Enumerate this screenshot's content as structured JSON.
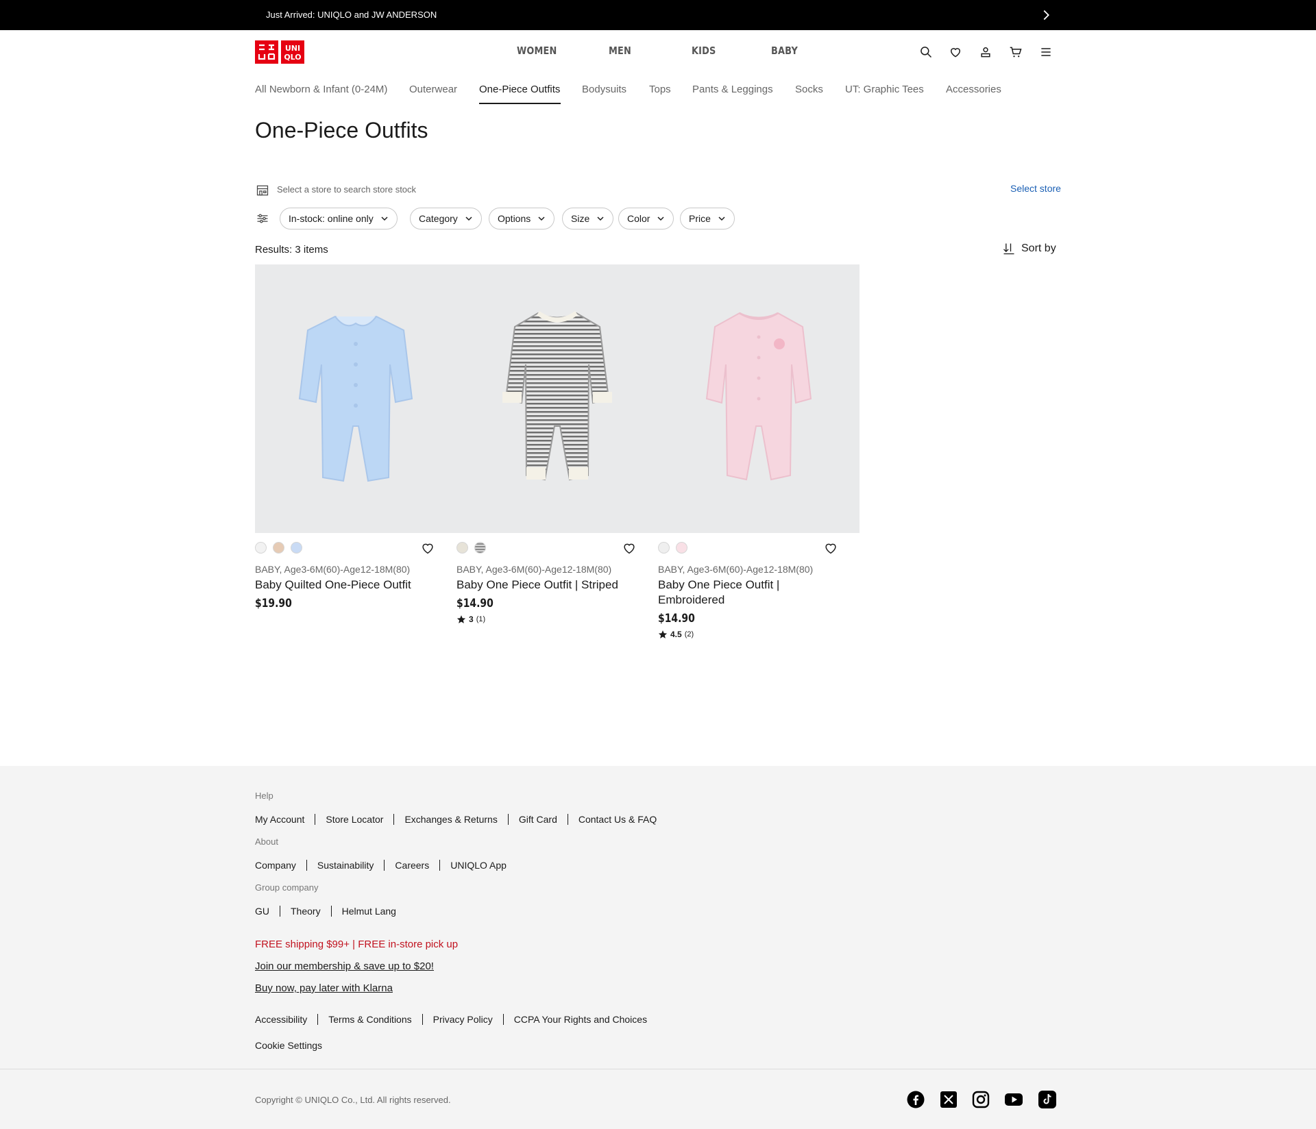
{
  "promo": {
    "text": "Just Arrived: UNIQLO and JW ANDERSON",
    "arrow_icon": "chevron-right-icon"
  },
  "logo": {
    "line1": "UNI",
    "line2": "QLO",
    "color": "#e60012"
  },
  "main_nav": [
    "WOMEN",
    "MEN",
    "KIDS",
    "BABY"
  ],
  "header_icons": [
    "search-icon",
    "heart-icon",
    "user-icon",
    "cart-icon",
    "menu-icon"
  ],
  "sub_nav": [
    "All Newborn & Infant (0-24M)",
    "Outerwear",
    "One-Piece Outfits",
    "Bodysuits",
    "Tops",
    "Pants & Leggings",
    "Socks",
    "UT: Graphic Tees",
    "Accessories"
  ],
  "sub_nav_active": "One-Piece Outfits",
  "page_title": "One-Piece Outfits",
  "store": {
    "text": "Select a store to search store stock",
    "link": "Select store"
  },
  "filters": [
    "In-stock: online only",
    "Category",
    "Options",
    "Size",
    "Color",
    "Price"
  ],
  "results_text": "Results: 3 items",
  "sort_label": "Sort by",
  "products": [
    {
      "meta": "BABY, Age3-6M(60)-Age12-18M(80)",
      "name": "Baby Quilted One-Piece Outfit",
      "price": "$19.90",
      "swatches": [
        "#f2f2f2",
        "#e6cbb5",
        "#c9dbf5"
      ],
      "garment_color": "#bcd7f5"
    },
    {
      "meta": "BABY, Age3-6M(60)-Age12-18M(80)",
      "name": "Baby One Piece Outfit | Striped",
      "price": "$14.90",
      "rating": "3",
      "rating_count": "(1)",
      "swatches": [
        "#e7e3d8",
        "#8a8a8a"
      ],
      "garment_color": "#9a9a9a"
    },
    {
      "meta": "BABY, Age3-6M(60)-Age12-18M(80)",
      "name": "Baby One Piece Outfit | Embroidered",
      "price": "$14.90",
      "rating": "4.5",
      "rating_count": "(2)",
      "swatches": [
        "#efefef",
        "#f9e0e6"
      ],
      "garment_color": "#f6d6df"
    }
  ],
  "footer": {
    "help_heading": "Help",
    "help_links": [
      "My Account",
      "Store Locator",
      "Exchanges & Returns",
      "Gift Card",
      "Contact Us & FAQ"
    ],
    "about_heading": "About",
    "about_links": [
      "Company",
      "Sustainability",
      "Careers",
      "UNIQLO App"
    ],
    "group_heading": "Group company",
    "group_links": [
      "GU",
      "Theory",
      "Helmut Lang"
    ],
    "shipping_promo": "FREE shipping $99+ | FREE in-store pick up",
    "membership_link": "Join our membership & save up to $20!",
    "klarna_link": "Buy now, pay later with Klarna",
    "legal_links": [
      "Accessibility",
      "Terms & Conditions",
      "Privacy Policy",
      "CCPA Your Rights and Choices"
    ],
    "cookie_settings": "Cookie Settings",
    "copyright": "Copyright © UNIQLO Co., Ltd. All rights reserved.",
    "social_icons": [
      "facebook-icon",
      "x-icon",
      "instagram-icon",
      "youtube-icon",
      "tiktok-icon"
    ]
  }
}
